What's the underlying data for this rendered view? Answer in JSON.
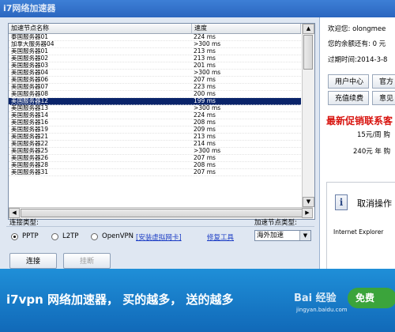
{
  "window": {
    "title": "i7网络加速器"
  },
  "server_table": {
    "col_name": "加速节点名称",
    "col_speed": "速度",
    "rows": [
      {
        "name": "泰国服务器01",
        "speed": "224 ms"
      },
      {
        "name": "加拿大服务器04",
        "speed": ">300 ms"
      },
      {
        "name": "美国服务器01",
        "speed": "213 ms"
      },
      {
        "name": "美国服务器02",
        "speed": "213 ms"
      },
      {
        "name": "美国服务器03",
        "speed": "201 ms"
      },
      {
        "name": "美国服务器04",
        "speed": ">300 ms"
      },
      {
        "name": "美国服务器06",
        "speed": "207 ms"
      },
      {
        "name": "美国服务器07",
        "speed": "223 ms"
      },
      {
        "name": "美国服务器08",
        "speed": "200 ms"
      },
      {
        "name": "美国服务器12",
        "speed": "199 ms",
        "selected": true
      },
      {
        "name": "美国服务器13",
        "speed": ">300 ms"
      },
      {
        "name": "美国服务器14",
        "speed": "224 ms"
      },
      {
        "name": "美国服务器16",
        "speed": "208 ms"
      },
      {
        "name": "美国服务器19",
        "speed": "209 ms"
      },
      {
        "name": "美国服务器21",
        "speed": "213 ms"
      },
      {
        "name": "美国服务器22",
        "speed": "214 ms"
      },
      {
        "name": "美国服务器25",
        "speed": ">300 ms"
      },
      {
        "name": "美国服务器26",
        "speed": "207 ms"
      },
      {
        "name": "美国服务器28",
        "speed": "208 ms"
      },
      {
        "name": "美国服务器31",
        "speed": "207 ms"
      }
    ]
  },
  "connection": {
    "type_label": "连接类型:",
    "options": [
      "PPTP",
      "L2TP",
      "OpenVPN"
    ],
    "selected": "PPTP",
    "install_link": "[安装虚拟网卡]",
    "repair_link": "修复工具",
    "node_type_label": "加速节点类型:",
    "node_type_value": "海外加速",
    "connect_button": "连接",
    "disconnect_button": "挂断"
  },
  "account": {
    "welcome": "欢迎您: olongmee",
    "balance": "您的余额还有: 0 元",
    "expiry": "过期时间:2014-3-8",
    "buttons": [
      "用户中心",
      "官方",
      "充值续费",
      "意见"
    ]
  },
  "promo": {
    "title": "最新促销联系客",
    "line1": "15元/周 购",
    "line2": "240元 年 购"
  },
  "notice": {
    "text": "取消操作",
    "browser": "Internet Explorer"
  },
  "banner": {
    "slogan": "i7vpn 网络加速器， 买的越多， 送的越多",
    "watermark": "Bai 经验",
    "watermark_url": "jingyan.baidu.com",
    "free_badge": "免费"
  }
}
